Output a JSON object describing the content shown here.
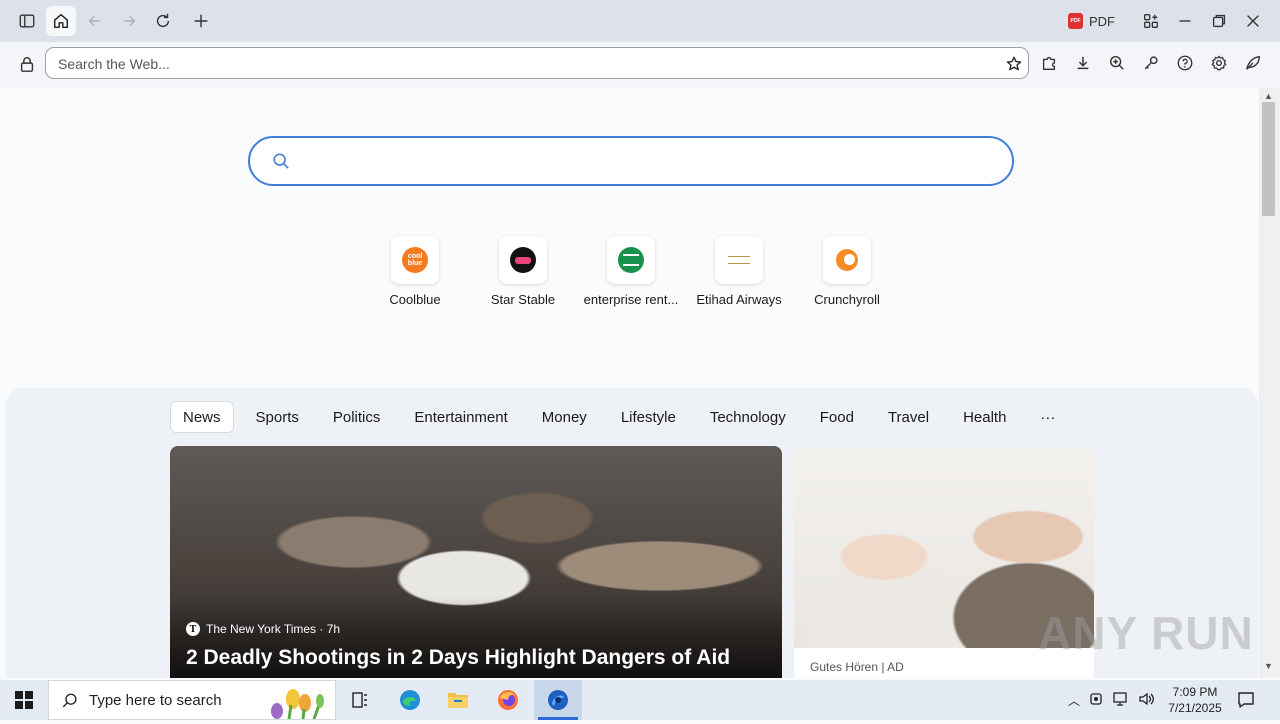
{
  "toolbar": {
    "address_placeholder": "Search the Web...",
    "pdf_label": "PDF",
    "pdf_badge": "PDF"
  },
  "newtab": {
    "search_placeholder": "",
    "tiles": [
      {
        "label": "Coolblue",
        "icon": "coolblue-icon",
        "icon_text": "cool blue",
        "color": "#f47b20"
      },
      {
        "label": "Star Stable",
        "icon": "star-stable-icon",
        "icon_text": "",
        "color": "#111111"
      },
      {
        "label": "enterprise rent...",
        "icon": "enterprise-icon",
        "icon_text": "",
        "color": "#16924c"
      },
      {
        "label": "Etihad Airways",
        "icon": "etihad-icon",
        "icon_text": "",
        "color": "#b8964a"
      },
      {
        "label": "Crunchyroll",
        "icon": "crunchyroll-icon",
        "icon_text": "",
        "color": "#f78b24"
      }
    ]
  },
  "feed": {
    "tabs": [
      "News",
      "Sports",
      "Politics",
      "Entertainment",
      "Money",
      "Lifestyle",
      "Technology",
      "Food",
      "Travel",
      "Health",
      "···"
    ],
    "active_tab": "News",
    "hero": {
      "source": "The New York Times · 7h",
      "source_logo": "T",
      "title": "2 Deadly Shootings in 2 Days Highlight Dangers of Aid"
    },
    "ad": {
      "label": "Gutes Hören | AD"
    }
  },
  "watermark": "ANY RUN",
  "taskbar": {
    "search_placeholder": "Type here to search",
    "time": "7:09 PM",
    "date": "7/21/2025"
  },
  "colors": {
    "accent": "#3f7fd9",
    "titlebar": "#dde2ea",
    "taskbar": "#e5ebf4"
  }
}
